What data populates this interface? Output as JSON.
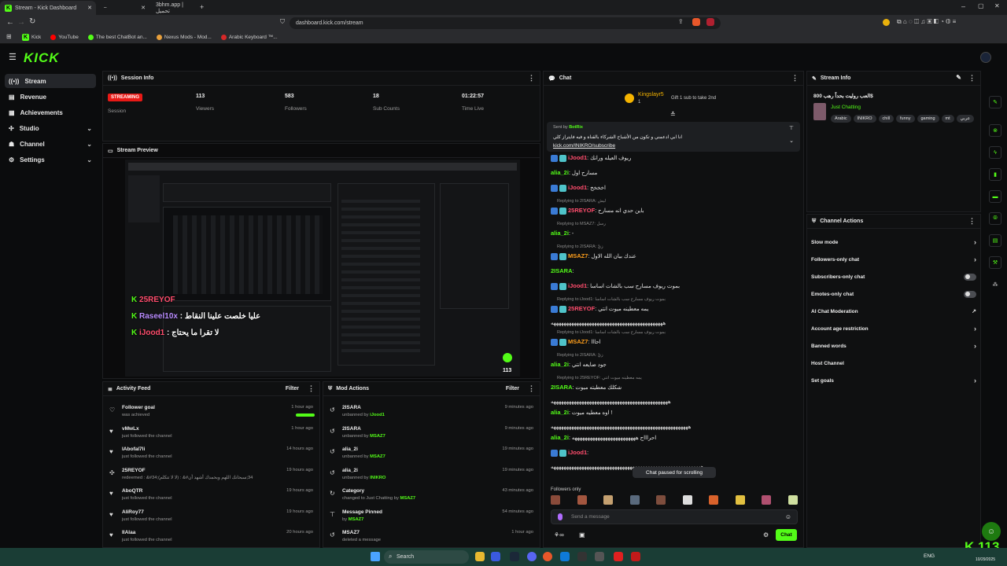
{
  "browser": {
    "tabs": [
      "Stream - Kick Dashboard",
      "✕",
      "3bhm.app | تحميل"
    ],
    "url": "dashboard.kick.com/stream",
    "bookmarks": [
      "Kick",
      "YouTube",
      "The best ChatBot an...",
      "Nexus Mods - Mod...",
      "Arabic Keyboard ™..."
    ]
  },
  "app": {
    "logo": "KICK"
  },
  "sidebar": {
    "items": [
      {
        "label": "Stream",
        "icon": "broadcast-icon"
      },
      {
        "label": "Revenue",
        "icon": "wallet-icon"
      },
      {
        "label": "Achievements",
        "icon": "trophy-icon"
      },
      {
        "label": "Studio",
        "icon": "studio-icon"
      },
      {
        "label": "Channel",
        "icon": "channel-icon"
      },
      {
        "label": "Settings",
        "icon": "gear-icon"
      }
    ]
  },
  "session": {
    "title": "Session Info",
    "status": "STREAMING",
    "status_label": "Session",
    "stats": [
      {
        "value": "113",
        "label": "Viewers"
      },
      {
        "value": "583",
        "label": "Followers"
      },
      {
        "value": "18",
        "label": "Sub Counts"
      },
      {
        "value": "01:22:57",
        "label": "Time Live"
      }
    ]
  },
  "preview": {
    "title": "Stream Preview",
    "overlay": [
      {
        "user": "25REYOF",
        "text": ""
      },
      {
        "user": "Raseel10x",
        "text": "عليا خلصت علينا النقاط"
      },
      {
        "user": "iJood1",
        "text": "لا تقرا ما يحتاج"
      }
    ],
    "viewer_badge": "113"
  },
  "activity": {
    "title": "Activity Feed",
    "filter": "Filter",
    "rows": [
      {
        "title": "Follower goal",
        "sub": "was achieved",
        "time": "1 hour ago"
      },
      {
        "title": "vMwLx",
        "sub": "just followed the channel",
        "time": "1 hour ago"
      },
      {
        "title": "IAbofal7li",
        "sub": "just followed the channel",
        "time": "14 hours ago"
      },
      {
        "title": "25REYOF",
        "sub": "redeemed : &#34;(لا لا تتكلم) : &#34;سبحانك اللهم وبحمدك أشهد أن",
        "time": "19 hours ago"
      },
      {
        "title": "AboQTR",
        "sub": "just followed the channel",
        "time": "19 hours ago"
      },
      {
        "title": "AliRoy77",
        "sub": "just followed the channel",
        "time": "19 hours ago"
      },
      {
        "title": "IlAlaa",
        "sub": "just followed the channel",
        "time": "20 hours ago"
      }
    ]
  },
  "mod": {
    "title": "Mod Actions",
    "filter": "Filter",
    "rows": [
      {
        "title": "2ISARA",
        "action": "unbanned by",
        "by": "iJood1",
        "time": "9 minutes ago"
      },
      {
        "title": "2ISARA",
        "action": "unbanned by",
        "by": "MSAZ7",
        "time": "9 minutes ago"
      },
      {
        "title": "alia_2i",
        "action": "unbanned by",
        "by": "MSAZ7",
        "time": "19 minutes ago"
      },
      {
        "title": "alia_2i",
        "action": "unbanned by",
        "by": "INIKRO",
        "time": "19 minutes ago"
      },
      {
        "title": "Category",
        "action": "changed to Just Chatting by",
        "by": "MSAZ7",
        "time": "43 minutes ago"
      },
      {
        "title": "Message Pinned",
        "action": "by",
        "by": "MSAZ7",
        "time": "54 minutes ago"
      },
      {
        "title": "MSAZ7",
        "action": "deleted a message",
        "by": "",
        "time": "1 hour ago"
      }
    ]
  },
  "chat": {
    "title": "Chat",
    "gifter": "Kingslayr5",
    "gifter_count": "1",
    "gift_text": "Gift 1 sub to take 2nd",
    "pinned": {
      "sent_by": "Sent by",
      "user": "BotRix",
      "text": "انا ابي ادعمني و تكون من الأشباح الشركاء بالقناة و فيه فايتراز كلي",
      "link": "kick.com/INIKRO/subscribe"
    },
    "lines": [
      {
        "reply": "",
        "user": "iJood1",
        "color": "#ff4d6d",
        "text": "ريوف العيله ورانك"
      },
      {
        "reply": "",
        "user": "alia_2i",
        "color": "#53fc18",
        "text": "مسارح اول"
      },
      {
        "reply": "",
        "user": "iJood1",
        "color": "#ff4d6d",
        "text": "اخخخخ"
      },
      {
        "reply": "Replying to 2ISARA: ليش",
        "user": "25REYOF",
        "color": "#ff4d6d",
        "text": "باين حدي انه مسارح"
      },
      {
        "reply": "Replying to MSAZ7: رسل",
        "user": "alia_2i",
        "color": "#53fc18",
        "text": "-"
      },
      {
        "reply": "Replying to 2ISARA: زيّ",
        "user": "MSAZ7",
        "color": "#ff9f1c",
        "text": "عندك بيان الله الاول"
      },
      {
        "reply": "",
        "user": "2ISARA",
        "color": "#53fc18",
        "text": ""
      },
      {
        "reply": "",
        "user": "iJood1",
        "color": "#ff4d6d",
        "text": "بموت ريوف مسارح سب بالشات اساسا"
      },
      {
        "reply": "Replying to iJood1: بموت ريوف مسارح سب بالشات اساسا",
        "user": "25REYOF",
        "color": "#ff4d6d",
        "text": "يمه معطينه ميوت انتي"
      },
      {
        "reply": "",
        "user": "",
        "color": "",
        "text": "ههههههههههههههههههههههههههههههههههههههههههههه"
      },
      {
        "reply": "Replying to iJood1: بموت ريوف مسارح سب بالشات اساسا",
        "user": "MSAZ7",
        "color": "#ff9f1c",
        "text": "احااا"
      },
      {
        "reply": "Replying to 2ISARA: زيّ",
        "user": "alia_2i",
        "color": "#53fc18",
        "text": "جود ضايعه انتي"
      },
      {
        "reply": "Replying to 25REYOF: يمه معطينه ميوت انتي",
        "user": "2ISARA",
        "color": "#53fc18",
        "text": "شكلك معطيته ميوت"
      },
      {
        "reply": "",
        "user": "",
        "color": "",
        "text": "ههههههههههههههههههههههههههههههههههههههههههههههه"
      },
      {
        "reply": "",
        "user": "alia_2i",
        "color": "#53fc18",
        "text": "اوه معطيه ميوت !"
      },
      {
        "reply": "",
        "user": "",
        "color": "",
        "text": "ههههههههههههههههههههههههههههههههههههههههههههههههههههههه"
      },
      {
        "reply": "",
        "user": "alia_2i",
        "color": "#53fc18",
        "text": "احراااج هههههههههههههههههههههههههه"
      },
      {
        "reply": "",
        "user": "iJood1",
        "color": "#ff4d6d",
        "text": ""
      },
      {
        "reply": "",
        "user": "",
        "color": "",
        "text": "هههههههههههههههههههههههههههههههههههههههههههههههههههههههههههه"
      }
    ],
    "paused": "Chat paused for scrolling",
    "followers_only": "Followers only",
    "placeholder": "Send a message",
    "send": "Chat"
  },
  "stream_info": {
    "title": "Stream Info",
    "stream_title": "العب روليت بحداً رهب 800$",
    "category": "Just Chatting",
    "tags": [
      "Arabic",
      "INIKRO",
      "chill",
      "funny",
      "gaming",
      "mt",
      "عربي"
    ]
  },
  "actions": {
    "title": "Channel Actions",
    "items": [
      {
        "label": "Slow mode",
        "kind": "arrow"
      },
      {
        "label": "Followers-only chat",
        "kind": "arrow"
      },
      {
        "label": "Subscribers-only chat",
        "kind": "toggle"
      },
      {
        "label": "Emotes-only chat",
        "kind": "toggle"
      },
      {
        "label": "AI Chat Moderation",
        "kind": "ext"
      },
      {
        "label": "Account age restriction",
        "kind": "arrow"
      },
      {
        "label": "Banned words",
        "kind": "arrow"
      },
      {
        "label": "Host Channel",
        "kind": "none"
      },
      {
        "label": "Set goals",
        "kind": "arrow"
      }
    ]
  },
  "taskbar": {
    "search": "Search",
    "lang": "ENG",
    "time": "",
    "date": "10/29/2025",
    "kick_viewers": "113"
  }
}
